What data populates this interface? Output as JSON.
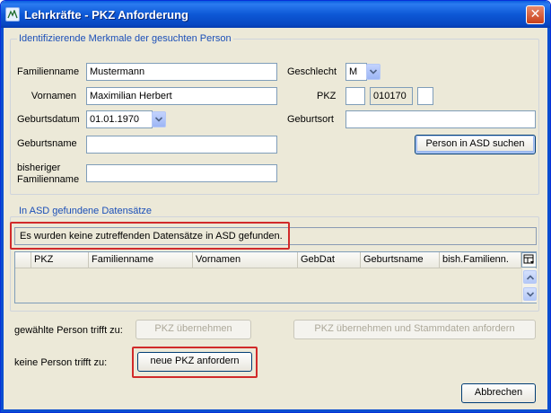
{
  "window": {
    "title": "Lehrkräfte - PKZ Anforderung",
    "close_symbol": "✕"
  },
  "group_person": {
    "title": "Identifizierende Merkmale der gesuchten Person",
    "familienname_label": "Familienname",
    "familienname_value": "Mustermann",
    "vornamen_label": "Vornamen",
    "vornamen_value": "Maximilian Herbert",
    "geburtsdatum_label": "Geburtsdatum",
    "geburtsdatum_value": "01.01.1970",
    "geburtsname_label": "Geburtsname",
    "geburtsname_value": "",
    "bisheriger_label_1": "bisheriger",
    "bisheriger_label_2": "Familienname",
    "bisheriger_value": "",
    "geschlecht_label": "Geschlecht",
    "geschlecht_value": "M",
    "pkz_label": "PKZ",
    "pkz_part1": "",
    "pkz_part2": "010170",
    "pkz_part3": "",
    "geburtsort_label": "Geburtsort",
    "geburtsort_value": "",
    "search_button": "Person in ASD suchen"
  },
  "group_asd": {
    "title": "In ASD gefundene Datensätze",
    "status_message": "Es wurden keine zutreffenden Datensätze in ASD gefunden.",
    "columns": [
      "PKZ",
      "Familienname",
      "Vornamen",
      "GebDat",
      "Geburtsname",
      "bish.Familienn."
    ],
    "rows": []
  },
  "actions": {
    "chosen_label": "gewählte Person trifft zu:",
    "pkz_uebernehmen": "PKZ übernehmen",
    "pkz_stammdaten": "PKZ übernehmen und Stammdaten anfordern",
    "none_label": "keine Person trifft zu:",
    "neue_pkz": "neue PKZ anfordern",
    "abbrechen": "Abbrechen"
  },
  "colors": {
    "highlight": "#d12a2a",
    "title_bar": "#0a5fdf",
    "group_title": "#1b4fb8"
  }
}
